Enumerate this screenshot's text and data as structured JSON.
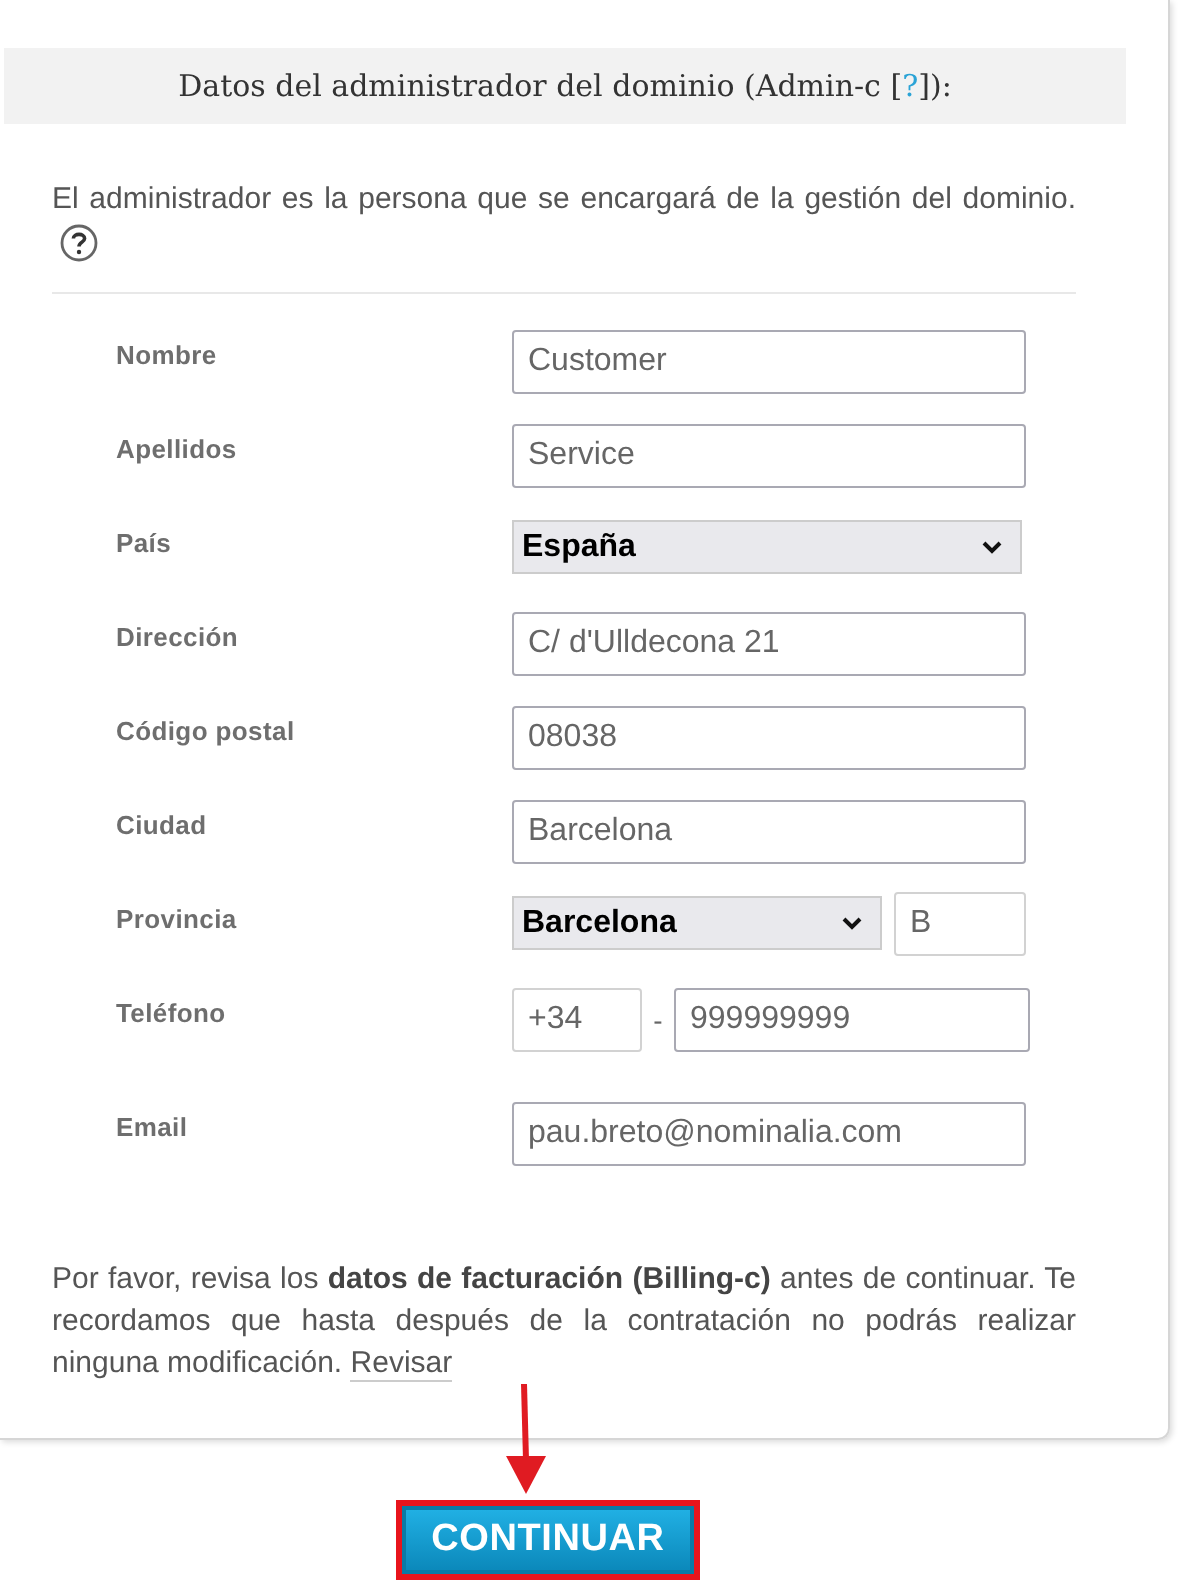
{
  "section": {
    "title_before": "Datos del administrador del dominio (Admin-c [",
    "help_link": "?",
    "title_after": "]):"
  },
  "intro": "El administrador es la persona que se encargará de la gestión del dominio.",
  "fields": [
    {
      "kind": "text",
      "label": "Nombre",
      "value": "Customer"
    },
    {
      "kind": "text",
      "label": "Apellidos",
      "value": "Service"
    },
    {
      "kind": "select",
      "label": "País",
      "value": "España"
    },
    {
      "kind": "text",
      "label": "Dirección",
      "value": "C/ d'Ulldecona 21"
    },
    {
      "kind": "text",
      "label": "Código postal",
      "value": "08038"
    },
    {
      "kind": "text",
      "label": "Ciudad",
      "value": "Barcelona"
    },
    {
      "kind": "select_code",
      "label": "Provincia",
      "value": "Barcelona",
      "code": "B"
    },
    {
      "kind": "phone",
      "label": "Teléfono",
      "prefix": "+34",
      "separator": "-",
      "value": "999999999"
    },
    {
      "kind": "text",
      "label": "Email",
      "value": "pau.breto@nominalia.com"
    }
  ],
  "notice": {
    "text": "Por favor, revisa los **datos de facturación (Billing-c)** antes de continuar. Te recordamos que hasta después de la contratación no podrás realizar ninguna modificación.",
    "link": "Revisar"
  },
  "button": "CONTINUAR"
}
